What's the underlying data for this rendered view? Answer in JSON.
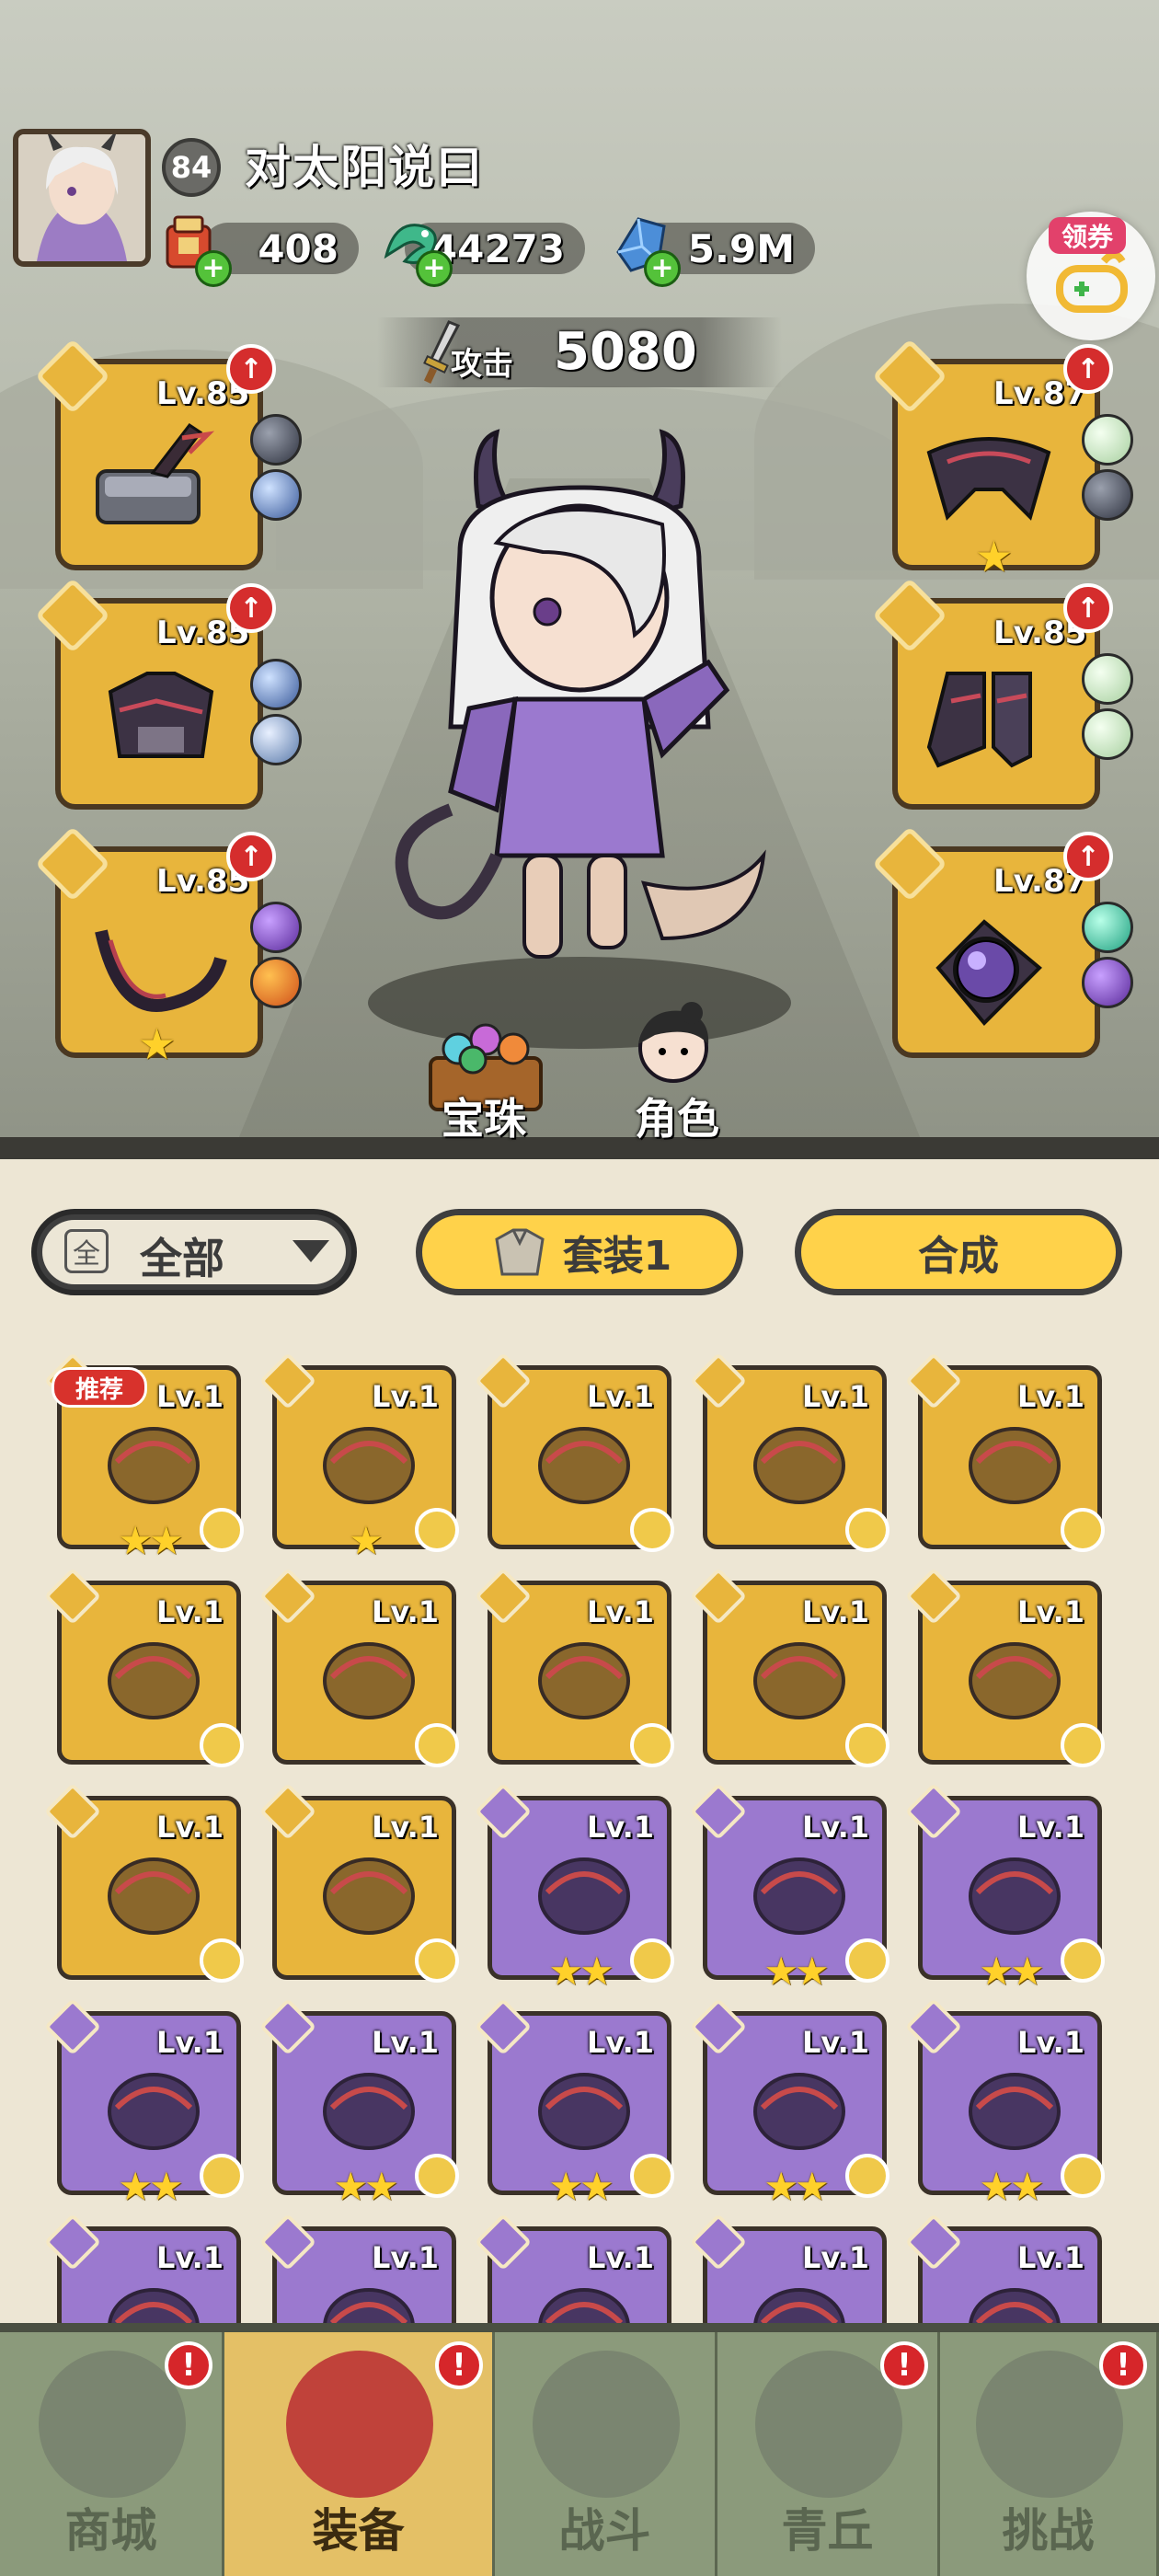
{
  "player": {
    "level": "84",
    "name": "对太阳说曰"
  },
  "resources": [
    {
      "icon": "scroll-bag-icon",
      "value": "408"
    },
    {
      "icon": "jade-dragon-icon",
      "value": "44273"
    },
    {
      "icon": "blue-crystal-icon",
      "value": "5.9M"
    }
  ],
  "coupon": {
    "label": "领券"
  },
  "attack": {
    "label": "攻击",
    "value": "5080"
  },
  "equipped_left": [
    {
      "slot": "weapon",
      "level": "Lv.85",
      "stars": 0
    },
    {
      "slot": "armor",
      "level": "Lv.85",
      "stars": 0
    },
    {
      "slot": "necklace",
      "level": "Lv.85",
      "stars": 1
    }
  ],
  "equipped_right": [
    {
      "slot": "belt",
      "level": "Lv.87",
      "stars": 1
    },
    {
      "slot": "boots",
      "level": "Lv.85",
      "stars": 0
    },
    {
      "slot": "ring",
      "level": "Lv.87",
      "stars": 0
    }
  ],
  "actions": {
    "pearl": "宝珠",
    "role": "角色"
  },
  "filter": {
    "icon_text": "全",
    "label": "全部",
    "set_button": "套装1",
    "synth_button": "合成"
  },
  "recommend_badge": "推荐",
  "inventory": [
    {
      "rarity": "gold",
      "level": "Lv.1",
      "stars": "★★",
      "kind": "bow"
    },
    {
      "rarity": "gold",
      "level": "Lv.1",
      "stars": "★",
      "kind": "staff"
    },
    {
      "rarity": "gold",
      "level": "Lv.1",
      "stars": "",
      "kind": "flower-staff"
    },
    {
      "rarity": "gold",
      "level": "Lv.1",
      "stars": "",
      "kind": "ice-armor"
    },
    {
      "rarity": "gold",
      "level": "Lv.1",
      "stars": "",
      "kind": "gold-armor"
    },
    {
      "rarity": "gold",
      "level": "Lv.1",
      "stars": "",
      "kind": "red-necklace"
    },
    {
      "rarity": "gold",
      "level": "Lv.1",
      "stars": "",
      "kind": "fur-necklace"
    },
    {
      "rarity": "gold",
      "level": "Lv.1",
      "stars": "",
      "kind": "lotus-belt"
    },
    {
      "rarity": "gold",
      "level": "Lv.1",
      "stars": "",
      "kind": "claw-belt"
    },
    {
      "rarity": "gold",
      "level": "Lv.1",
      "stars": "",
      "kind": "ice-boots"
    },
    {
      "rarity": "gold",
      "level": "Lv.1",
      "stars": "",
      "kind": "gold-boots"
    },
    {
      "rarity": "gold",
      "level": "Lv.1",
      "stars": "",
      "kind": "ice-ring"
    },
    {
      "rarity": "purple",
      "level": "Lv.1",
      "stars": "★★",
      "kind": "bow"
    },
    {
      "rarity": "purple",
      "level": "Lv.1",
      "stars": "★★",
      "kind": "hammer"
    },
    {
      "rarity": "purple",
      "level": "Lv.1",
      "stars": "★★",
      "kind": "flame-armor"
    },
    {
      "rarity": "purple",
      "level": "Lv.1",
      "stars": "★★",
      "kind": "red-necklace"
    },
    {
      "rarity": "purple",
      "level": "Lv.1",
      "stars": "★★",
      "kind": "thunder-necklace"
    },
    {
      "rarity": "purple",
      "level": "Lv.1",
      "stars": "★★",
      "kind": "fur-necklace"
    },
    {
      "rarity": "purple",
      "level": "Lv.1",
      "stars": "★★",
      "kind": "ice-belt"
    },
    {
      "rarity": "purple",
      "level": "Lv.1",
      "stars": "★★",
      "kind": "red-boots"
    },
    {
      "rarity": "purple",
      "level": "Lv.1",
      "stars": "",
      "kind": "dark-armor"
    },
    {
      "rarity": "purple",
      "level": "Lv.1",
      "stars": "",
      "kind": "gold-boots"
    },
    {
      "rarity": "purple",
      "level": "Lv.1",
      "stars": "",
      "kind": "fire-ring"
    },
    {
      "rarity": "purple",
      "level": "Lv.1",
      "stars": "",
      "kind": "gold-ring"
    },
    {
      "rarity": "purple",
      "level": "Lv.1",
      "stars": "",
      "kind": "staff"
    }
  ],
  "nav": [
    {
      "label": "商城",
      "icon": "shop-icon",
      "alert": true,
      "active": false
    },
    {
      "label": "装备",
      "icon": "helmet-icon",
      "alert": true,
      "active": true
    },
    {
      "label": "战斗",
      "icon": "crossed-swords-icon",
      "alert": false,
      "active": false
    },
    {
      "label": "青丘",
      "icon": "mountain-icon",
      "alert": true,
      "active": false
    },
    {
      "label": "挑战",
      "icon": "vortex-icon",
      "alert": true,
      "active": false
    }
  ],
  "colors": {
    "gold": "#e8b53c",
    "purple": "#9b79cf",
    "accent_red": "#d52d2d",
    "button_yellow": "#ffd24a"
  }
}
